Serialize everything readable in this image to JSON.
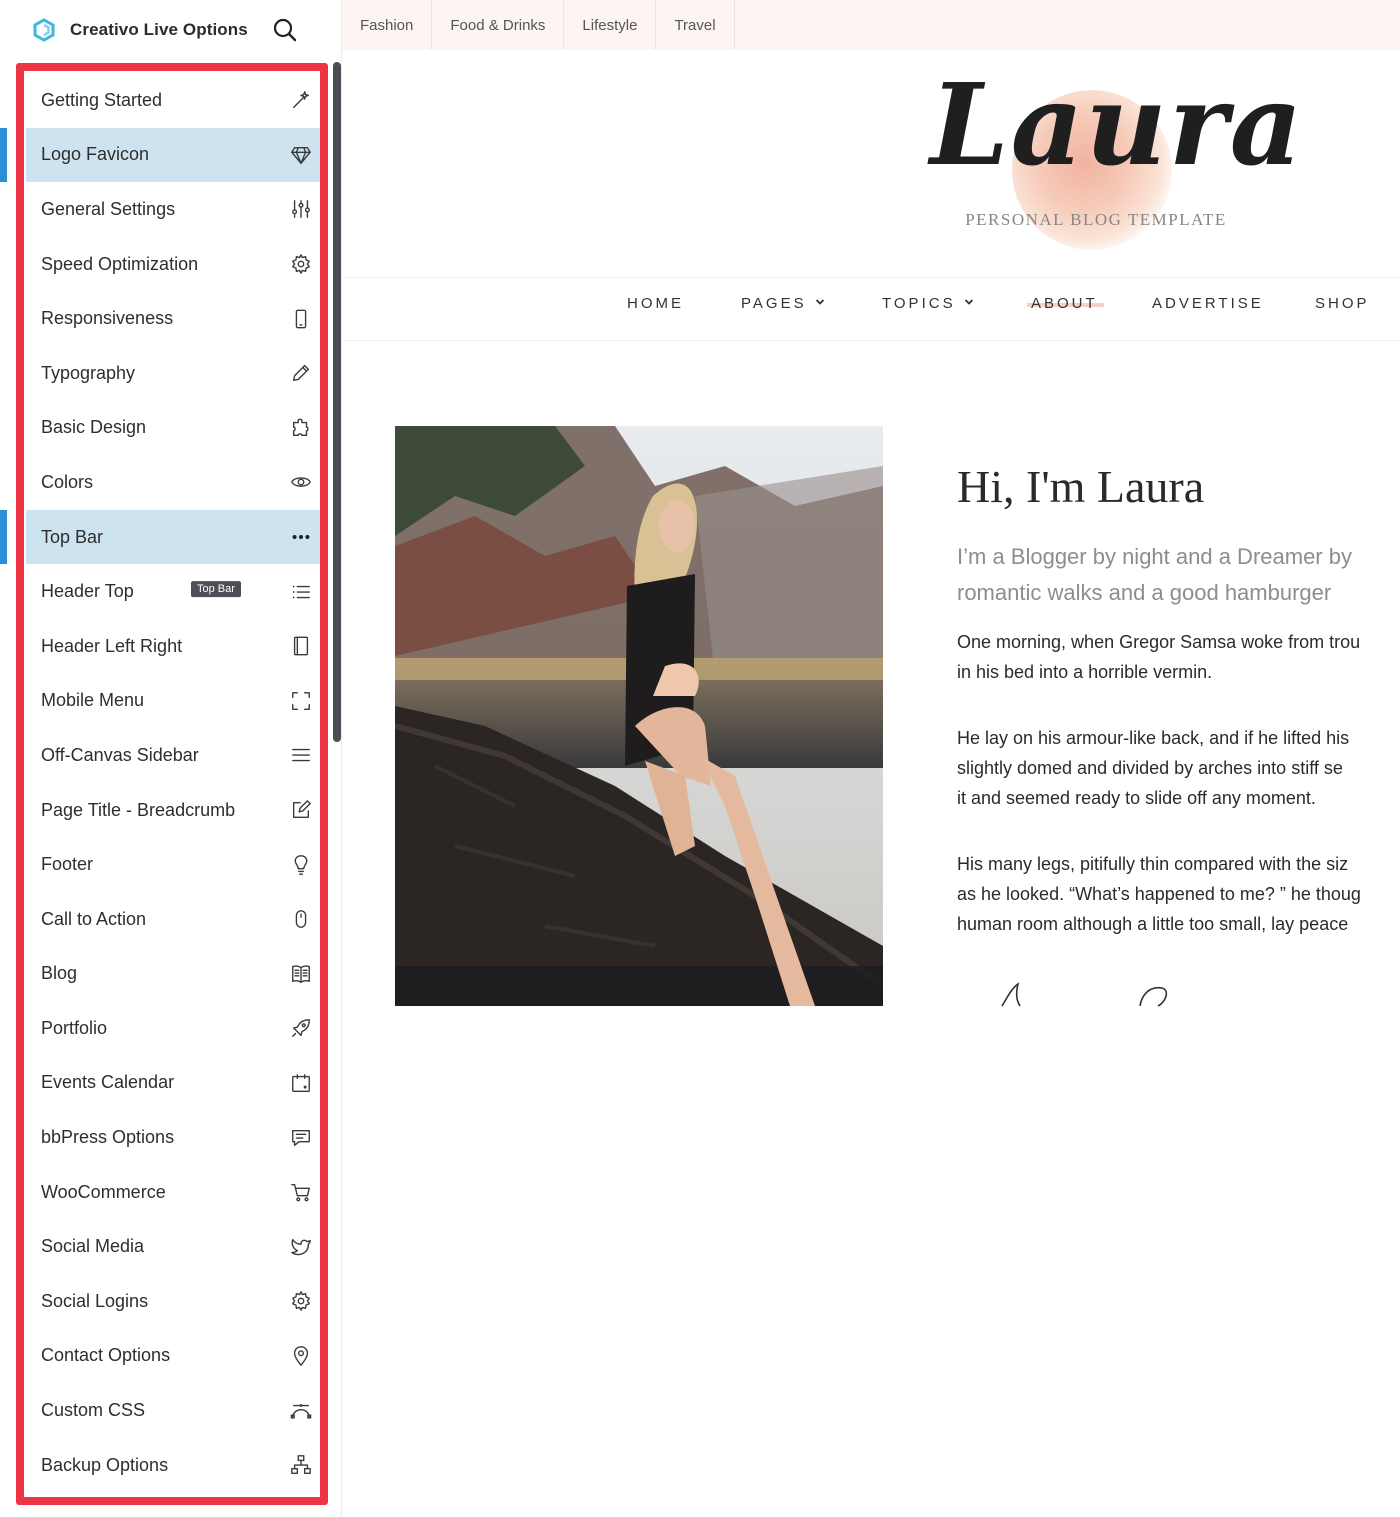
{
  "app": {
    "title": "Creativo Live Options",
    "logo_icon": "hexagon-logo-icon",
    "search_icon": "search-icon",
    "accent": "#2a8fd6",
    "highlight": "#ee3344"
  },
  "sidebar": {
    "items": [
      {
        "label": "Getting Started",
        "icon": "magic-wand-icon"
      },
      {
        "label": "Logo Favicon",
        "icon": "diamond-icon",
        "active": true
      },
      {
        "label": "General Settings",
        "icon": "sliders-icon"
      },
      {
        "label": "Speed Optimization",
        "icon": "gear-icon"
      },
      {
        "label": "Responsiveness",
        "icon": "mobile-icon"
      },
      {
        "label": "Typography",
        "icon": "pencil-icon"
      },
      {
        "label": "Basic Design",
        "icon": "puzzle-icon"
      },
      {
        "label": "Colors",
        "icon": "eye-icon"
      },
      {
        "label": "Top Bar",
        "icon": "ellipsis-icon",
        "active": true
      },
      {
        "label": "Header Top",
        "icon": "list-icon",
        "tooltip": "Top Bar"
      },
      {
        "label": "Header Left Right",
        "icon": "columns-icon"
      },
      {
        "label": "Mobile Menu",
        "icon": "expand-icon"
      },
      {
        "label": "Off-Canvas Sidebar",
        "icon": "menu-icon"
      },
      {
        "label": "Page Title - Breadcrumb",
        "icon": "edit-icon"
      },
      {
        "label": "Footer",
        "icon": "lightbulb-icon"
      },
      {
        "label": "Call to Action",
        "icon": "mouse-icon"
      },
      {
        "label": "Blog",
        "icon": "book-icon"
      },
      {
        "label": "Portfolio",
        "icon": "rocket-icon"
      },
      {
        "label": "Events Calendar",
        "icon": "calendar-icon"
      },
      {
        "label": "bbPress Options",
        "icon": "chat-icon"
      },
      {
        "label": "WooCommerce",
        "icon": "cart-icon"
      },
      {
        "label": "Social Media",
        "icon": "twitter-icon"
      },
      {
        "label": "Social Logins",
        "icon": "gear-icon"
      },
      {
        "label": "Contact Options",
        "icon": "map-pin-icon"
      },
      {
        "label": "Custom CSS",
        "icon": "bezier-icon"
      },
      {
        "label": "Backup Options",
        "icon": "sitemap-icon"
      }
    ]
  },
  "preview": {
    "topbar": [
      "Fashion",
      "Food & Drinks",
      "Lifestyle",
      "Travel"
    ],
    "brand": {
      "logo_text": "Laura",
      "tagline": "PERSONAL BLOG TEMPLATE"
    },
    "nav": [
      {
        "label": "HOME"
      },
      {
        "label": "PAGES",
        "dropdown": true
      },
      {
        "label": "TOPICS",
        "dropdown": true
      },
      {
        "label": "ABOUT",
        "current": true
      },
      {
        "label": "ADVERTISE"
      },
      {
        "label": "SHOP"
      }
    ],
    "intro": {
      "heading": "Hi, I'm Laura",
      "lead": [
        "I’m a Blogger by night and a Dreamer by",
        "romantic walks and a good hamburger"
      ],
      "para1": [
        "One morning, when Gregor Samsa woke from trou",
        "in his bed into a horrible vermin."
      ],
      "para2": [
        "He lay on his armour-like back, and if he lifted his",
        "slightly domed and divided by arches into stiff se",
        "it and seemed ready to slide off any moment."
      ],
      "para3": [
        "His many legs, pitifully thin compared with the siz",
        "as he looked. “What’s happened to me? ” he thoug",
        "human room although a little too small, lay peace"
      ]
    }
  }
}
